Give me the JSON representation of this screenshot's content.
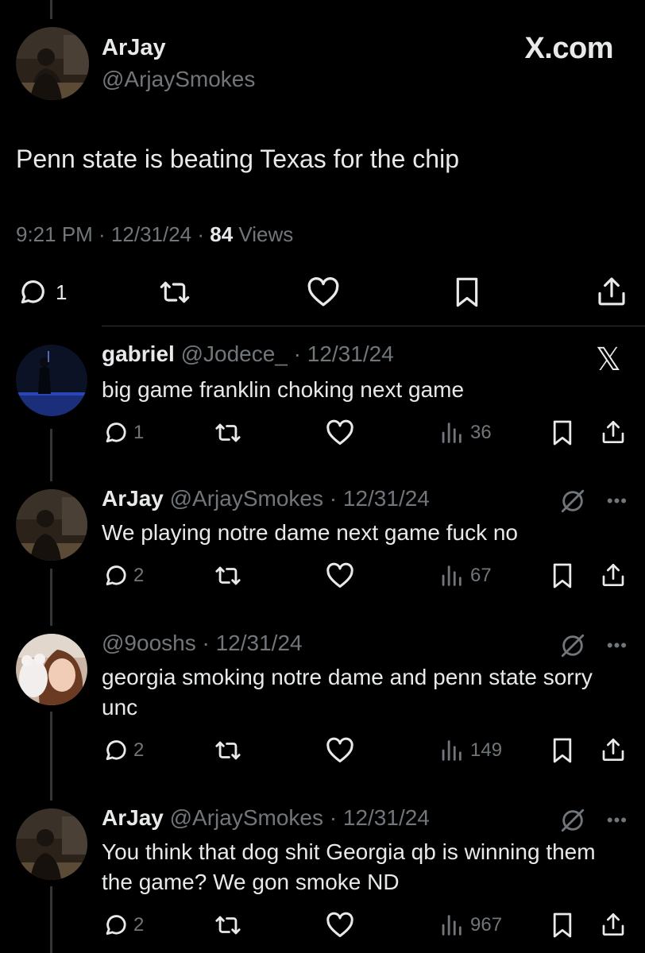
{
  "brand": {
    "site": "X.com"
  },
  "main_post": {
    "name": "ArJay",
    "handle": "@ArjaySmokes",
    "text": "Penn state is beating Texas for the chip",
    "time": "9:21 PM · 12/31/24 · ",
    "views_count": "84",
    "views_label": " Views",
    "reply_count": "1"
  },
  "replies": [
    {
      "name": "gabriel",
      "handle_date": "@Jodece_ · 12/31/24",
      "text": "big game franklin choking next game",
      "reply_count": "1",
      "view_count": "36"
    },
    {
      "name": "ArJay",
      "handle_date": "@ArjaySmokes · 12/31/24",
      "text": "We playing notre dame next game fuck no",
      "reply_count": "2",
      "view_count": "67"
    },
    {
      "name": "",
      "handle_date": "@9ooshs · 12/31/24",
      "text": "georgia smoking notre dame and penn state sorry unc",
      "reply_count": "2",
      "view_count": "149"
    },
    {
      "name": "ArJay",
      "handle_date": "@ArjaySmokes · 12/31/24",
      "text": "You think that dog shit Georgia qb is winning them the game? We gon smoke ND",
      "reply_count": "2",
      "view_count": "967"
    }
  ],
  "icons": {
    "reply": "reply-icon",
    "retweet": "retweet-icon",
    "like": "heart-icon",
    "bookmark": "bookmark-icon",
    "share": "share-icon",
    "views": "views-icon",
    "grok": "grok-icon",
    "more": "more-icon",
    "x_logo": "x-logo-icon"
  },
  "colors": {
    "background": "#000000",
    "text": "#e7e9ea",
    "muted": "#71767b",
    "divider": "#2f3336"
  }
}
